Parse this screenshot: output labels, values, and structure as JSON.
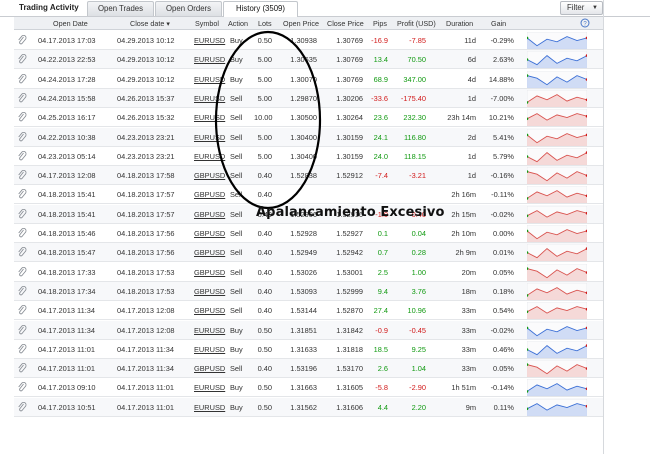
{
  "app": {
    "title": "Trading Activity",
    "tabs": [
      {
        "label": "Open Trades",
        "active": false
      },
      {
        "label": "Open Orders",
        "active": false
      },
      {
        "label": "History (3509)",
        "active": true
      }
    ],
    "filter_label": "Filter",
    "help_icon": "help-icon"
  },
  "table": {
    "headers": [
      "Open Date",
      "Close date ▾",
      "Symbol",
      "Action",
      "Lots",
      "Open Price",
      "Close Price",
      "Pips",
      "Profit (USD)",
      "Duration",
      "Gain"
    ],
    "rows": [
      {
        "open": "04.17.2013 17:03",
        "close": "04.29.2013 10:12",
        "sym": "EURUSD",
        "act": "Buy",
        "lots": "0.50",
        "op": "1.30938",
        "cp": "1.30769",
        "pips": "-16.9",
        "profit": "-7.85",
        "dur": "11d",
        "gain": "-0.29%",
        "spark": "blue"
      },
      {
        "open": "04.22.2013 22:53",
        "close": "04.29.2013 10:12",
        "sym": "EURUSD",
        "act": "Buy",
        "lots": "5.00",
        "op": "1.30635",
        "cp": "1.30769",
        "pips": "13.4",
        "profit": "70.50",
        "dur": "6d",
        "gain": "2.63%",
        "spark": "blue"
      },
      {
        "open": "04.24.2013 17:28",
        "close": "04.29.2013 10:12",
        "sym": "EURUSD",
        "act": "Buy",
        "lots": "5.00",
        "op": "1.30070",
        "cp": "1.30769",
        "pips": "68.9",
        "profit": "347.00",
        "dur": "4d",
        "gain": "14.88%",
        "spark": "blue"
      },
      {
        "open": "04.24.2013 15:58",
        "close": "04.26.2013 15:37",
        "sym": "EURUSD",
        "act": "Sell",
        "lots": "5.00",
        "op": "1.29870",
        "cp": "1.30206",
        "pips": "-33.6",
        "profit": "-175.40",
        "dur": "1d",
        "gain": "-7.00%",
        "spark": "red"
      },
      {
        "open": "04.25.2013 16:17",
        "close": "04.26.2013 15:32",
        "sym": "EURUSD",
        "act": "Sell",
        "lots": "10.00",
        "op": "1.30500",
        "cp": "1.30264",
        "pips": "23.6",
        "profit": "232.30",
        "dur": "23h 14m",
        "gain": "10.21%",
        "spark": "red"
      },
      {
        "open": "04.22.2013 10:38",
        "close": "04.23.2013 23:21",
        "sym": "EURUSD",
        "act": "Sell",
        "lots": "5.00",
        "op": "1.30400",
        "cp": "1.30159",
        "pips": "24.1",
        "profit": "116.80",
        "dur": "2d",
        "gain": "5.41%",
        "spark": "red"
      },
      {
        "open": "04.23.2013 05:14",
        "close": "04.23.2013 23:21",
        "sym": "EURUSD",
        "act": "Sell",
        "lots": "5.00",
        "op": "1.30400",
        "cp": "1.30159",
        "pips": "24.0",
        "profit": "118.15",
        "dur": "1d",
        "gain": "5.79%",
        "spark": "red"
      },
      {
        "open": "04.17.2013 12:08",
        "close": "04.18.2013 17:58",
        "sym": "GBPUSD",
        "act": "Sell",
        "lots": "0.40",
        "op": "1.52838",
        "cp": "1.52912",
        "pips": "-7.4",
        "profit": "-3.21",
        "dur": "1d",
        "gain": "-0.16%",
        "spark": "red"
      },
      {
        "open": "04.18.2013 15:41",
        "close": "04.18.2013 17:57",
        "sym": "GBPUSD",
        "act": "Sell",
        "lots": "0.40",
        "op": "",
        "cp": "",
        "pips": "",
        "profit": "",
        "dur": "2h 16m",
        "gain": "-0.11%",
        "spark": "red"
      },
      {
        "open": "04.18.2013 15:41",
        "close": "04.18.2013 17:57",
        "sym": "GBPUSD",
        "act": "Sell",
        "lots": "0.40",
        "op": "1.52906",
        "cp": "1.52916",
        "pips": "-1.0",
        "profit": "-0.40",
        "dur": "2h 15m",
        "gain": "-0.02%",
        "spark": "red"
      },
      {
        "open": "04.18.2013 15:46",
        "close": "04.18.2013 17:56",
        "sym": "GBPUSD",
        "act": "Sell",
        "lots": "0.40",
        "op": "1.52928",
        "cp": "1.52927",
        "pips": "0.1",
        "profit": "0.04",
        "dur": "2h 10m",
        "gain": "0.00%",
        "spark": "red"
      },
      {
        "open": "04.18.2013 15:47",
        "close": "04.18.2013 17:56",
        "sym": "GBPUSD",
        "act": "Sell",
        "lots": "0.40",
        "op": "1.52949",
        "cp": "1.52942",
        "pips": "0.7",
        "profit": "0.28",
        "dur": "2h 9m",
        "gain": "0.01%",
        "spark": "red"
      },
      {
        "open": "04.18.2013 17:33",
        "close": "04.18.2013 17:53",
        "sym": "GBPUSD",
        "act": "Sell",
        "lots": "0.40",
        "op": "1.53026",
        "cp": "1.53001",
        "pips": "2.5",
        "profit": "1.00",
        "dur": "20m",
        "gain": "0.05%",
        "spark": "red"
      },
      {
        "open": "04.18.2013 17:34",
        "close": "04.18.2013 17:53",
        "sym": "GBPUSD",
        "act": "Sell",
        "lots": "0.40",
        "op": "1.53093",
        "cp": "1.52999",
        "pips": "9.4",
        "profit": "3.76",
        "dur": "18m",
        "gain": "0.18%",
        "spark": "red"
      },
      {
        "open": "04.17.2013 11:34",
        "close": "04.17.2013 12:08",
        "sym": "GBPUSD",
        "act": "Sell",
        "lots": "0.40",
        "op": "1.53144",
        "cp": "1.52870",
        "pips": "27.4",
        "profit": "10.96",
        "dur": "33m",
        "gain": "0.54%",
        "spark": "red"
      },
      {
        "open": "04.17.2013 11:34",
        "close": "04.17.2013 12:08",
        "sym": "EURUSD",
        "act": "Buy",
        "lots": "0.50",
        "op": "1.31851",
        "cp": "1.31842",
        "pips": "-0.9",
        "profit": "-0.45",
        "dur": "33m",
        "gain": "-0.02%",
        "spark": "blue"
      },
      {
        "open": "04.17.2013 11:01",
        "close": "04.17.2013 11:34",
        "sym": "EURUSD",
        "act": "Buy",
        "lots": "0.50",
        "op": "1.31633",
        "cp": "1.31818",
        "pips": "18.5",
        "profit": "9.25",
        "dur": "33m",
        "gain": "0.46%",
        "spark": "blue"
      },
      {
        "open": "04.17.2013 11:01",
        "close": "04.17.2013 11:34",
        "sym": "GBPUSD",
        "act": "Sell",
        "lots": "0.40",
        "op": "1.53196",
        "cp": "1.53170",
        "pips": "2.6",
        "profit": "1.04",
        "dur": "33m",
        "gain": "0.05%",
        "spark": "red"
      },
      {
        "open": "04.17.2013 09:10",
        "close": "04.17.2013 11:01",
        "sym": "EURUSD",
        "act": "Buy",
        "lots": "0.50",
        "op": "1.31663",
        "cp": "1.31605",
        "pips": "-5.8",
        "profit": "-2.90",
        "dur": "1h 51m",
        "gain": "-0.14%",
        "spark": "blue"
      },
      {
        "open": "04.17.2013 10:51",
        "close": "04.17.2013 11:01",
        "sym": "EURUSD",
        "act": "Buy",
        "lots": "0.50",
        "op": "1.31562",
        "cp": "1.31606",
        "pips": "4.4",
        "profit": "2.20",
        "dur": "9m",
        "gain": "0.11%",
        "spark": "blue"
      }
    ]
  },
  "annotation": {
    "text": "Apalancamiento Excesivo"
  },
  "colors": {
    "positive": "#119a11",
    "negative": "#d11a1a",
    "spark_buy": "#3b6fd6",
    "spark_sell": "#d9534f"
  }
}
